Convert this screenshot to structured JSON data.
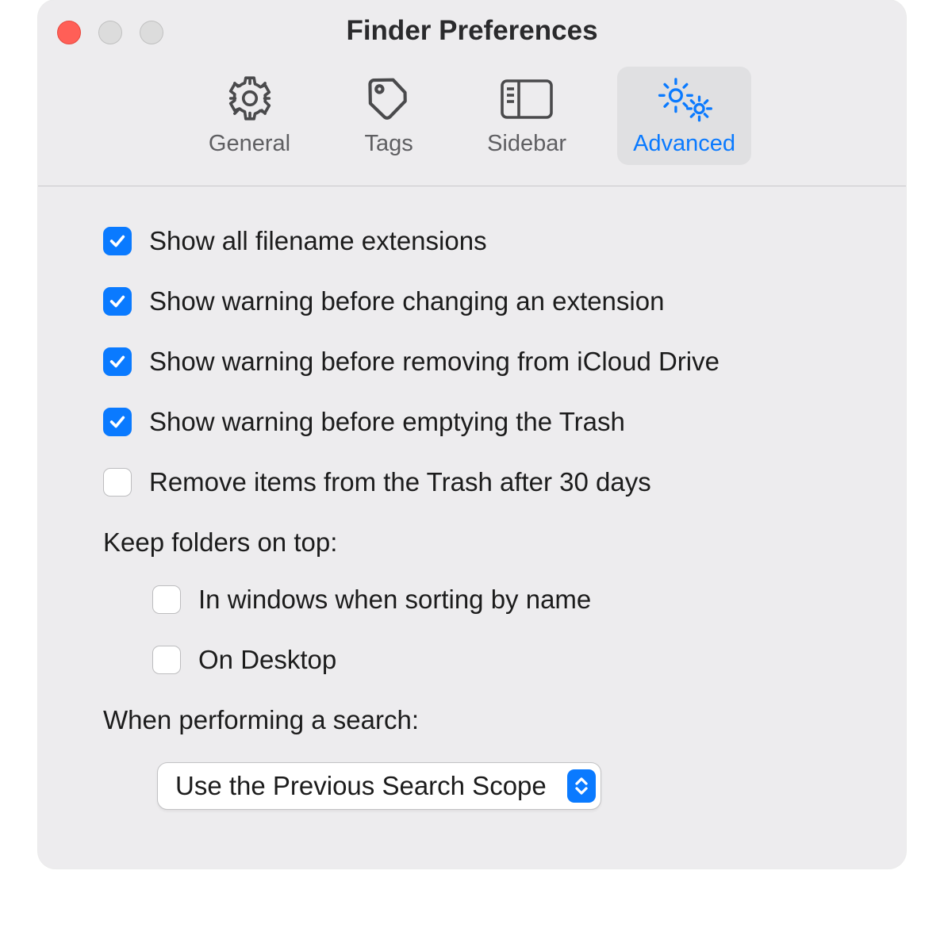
{
  "window": {
    "title": "Finder Preferences"
  },
  "tabs": [
    {
      "label": "General",
      "icon": "gear-icon",
      "active": false
    },
    {
      "label": "Tags",
      "icon": "tag-icon",
      "active": false
    },
    {
      "label": "Sidebar",
      "icon": "sidebar-icon",
      "active": false
    },
    {
      "label": "Advanced",
      "icon": "gears-icon",
      "active": true
    }
  ],
  "options": [
    {
      "label": "Show all filename extensions",
      "checked": true
    },
    {
      "label": "Show warning before changing an extension",
      "checked": true
    },
    {
      "label": "Show warning before removing from iCloud Drive",
      "checked": true
    },
    {
      "label": "Show warning before emptying the Trash",
      "checked": true
    },
    {
      "label": "Remove items from the Trash after 30 days",
      "checked": false
    }
  ],
  "keep_folders": {
    "heading": "Keep folders on top:",
    "items": [
      {
        "label": "In windows when sorting by name",
        "checked": false
      },
      {
        "label": "On Desktop",
        "checked": false
      }
    ]
  },
  "search": {
    "heading": "When performing a search:",
    "selected": "Use the Previous Search Scope"
  }
}
